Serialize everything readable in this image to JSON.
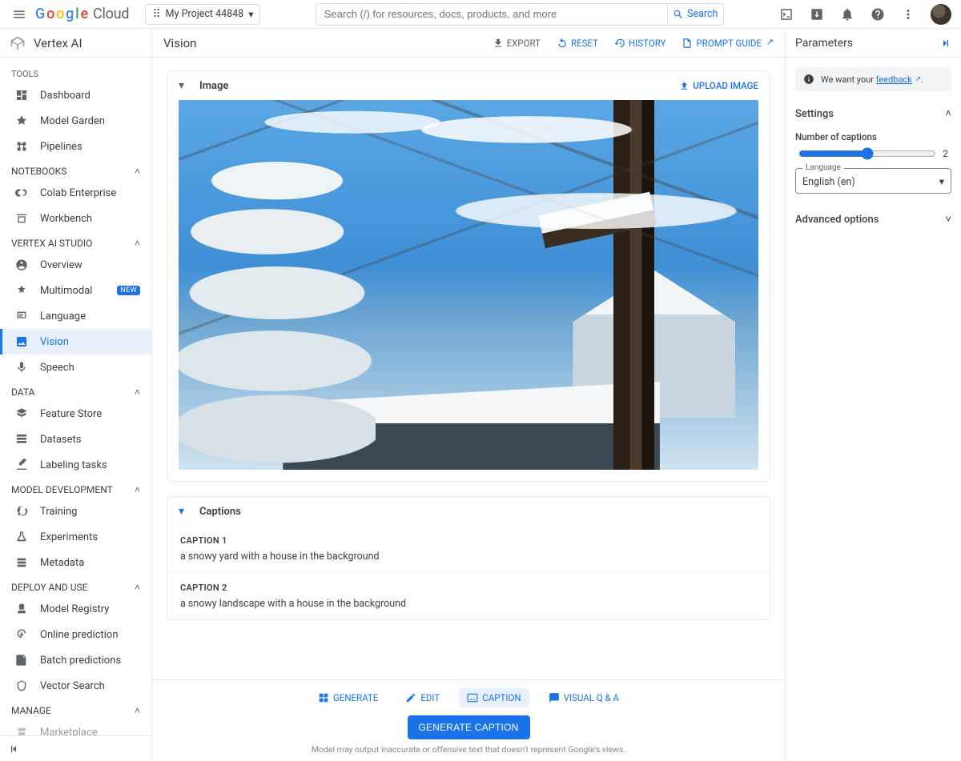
{
  "topbar": {
    "logo_cloud": "Cloud",
    "project_name": "My Project 44848",
    "search_placeholder": "Search (/) for resources, docs, products, and more",
    "search_button": "Search"
  },
  "product": {
    "name": "Vertex AI"
  },
  "sidebar": {
    "sections": [
      {
        "label": "TOOLS",
        "collapsible": false,
        "items": [
          {
            "label": "Dashboard",
            "icon": "dashboard-icon"
          },
          {
            "label": "Model Garden",
            "icon": "model-garden-icon"
          },
          {
            "label": "Pipelines",
            "icon": "pipelines-icon"
          }
        ]
      },
      {
        "label": "NOTEBOOKS",
        "collapsible": true,
        "items": [
          {
            "label": "Colab Enterprise",
            "icon": "colab-icon"
          },
          {
            "label": "Workbench",
            "icon": "workbench-icon"
          }
        ]
      },
      {
        "label": "VERTEX AI STUDIO",
        "collapsible": true,
        "items": [
          {
            "label": "Overview",
            "icon": "overview-icon"
          },
          {
            "label": "Multimodal",
            "icon": "multimodal-icon",
            "badge": "NEW"
          },
          {
            "label": "Language",
            "icon": "language-icon"
          },
          {
            "label": "Vision",
            "icon": "vision-icon",
            "selected": true
          },
          {
            "label": "Speech",
            "icon": "speech-icon"
          }
        ]
      },
      {
        "label": "DATA",
        "collapsible": true,
        "items": [
          {
            "label": "Feature Store",
            "icon": "feature-store-icon"
          },
          {
            "label": "Datasets",
            "icon": "datasets-icon"
          },
          {
            "label": "Labeling tasks",
            "icon": "labeling-icon"
          }
        ]
      },
      {
        "label": "MODEL DEVELOPMENT",
        "collapsible": true,
        "items": [
          {
            "label": "Training",
            "icon": "training-icon"
          },
          {
            "label": "Experiments",
            "icon": "experiments-icon"
          },
          {
            "label": "Metadata",
            "icon": "metadata-icon"
          }
        ]
      },
      {
        "label": "DEPLOY AND USE",
        "collapsible": true,
        "items": [
          {
            "label": "Model Registry",
            "icon": "registry-icon"
          },
          {
            "label": "Online prediction",
            "icon": "online-pred-icon"
          },
          {
            "label": "Batch predictions",
            "icon": "batch-pred-icon"
          },
          {
            "label": "Vector Search",
            "icon": "vector-icon"
          }
        ]
      },
      {
        "label": "MANAGE",
        "collapsible": true,
        "items": [
          {
            "label": "Marketplace",
            "icon": "marketplace-icon",
            "muted": true
          }
        ]
      }
    ]
  },
  "main": {
    "title": "Vision",
    "actions": {
      "export": "EXPORT",
      "reset": "RESET",
      "history": "HISTORY",
      "prompt_guide": "PROMPT GUIDE"
    },
    "image_card": {
      "title": "Image",
      "upload": "UPLOAD IMAGE"
    },
    "captions_card": {
      "title": "Captions",
      "items": [
        {
          "label": "CAPTION 1",
          "text": "a snowy yard with a house in the background"
        },
        {
          "label": "CAPTION 2",
          "text": "a snowy landscape with a house in the background"
        }
      ]
    },
    "modes": {
      "generate": "GENERATE",
      "edit": "EDIT",
      "caption": "CAPTION",
      "visual_qa": "VISUAL Q & A"
    },
    "generate_button": "GENERATE CAPTION",
    "disclaimer": "Model may output inaccurate or offensive text that doesn't represent Google's views."
  },
  "params": {
    "title": "Parameters",
    "feedback_pre": "We want your ",
    "feedback_link": "feedback",
    "settings_title": "Settings",
    "n_captions_label": "Number of captions",
    "n_captions_value": "2",
    "language_label": "Language",
    "language_value": "English (en)",
    "advanced_title": "Advanced options"
  }
}
